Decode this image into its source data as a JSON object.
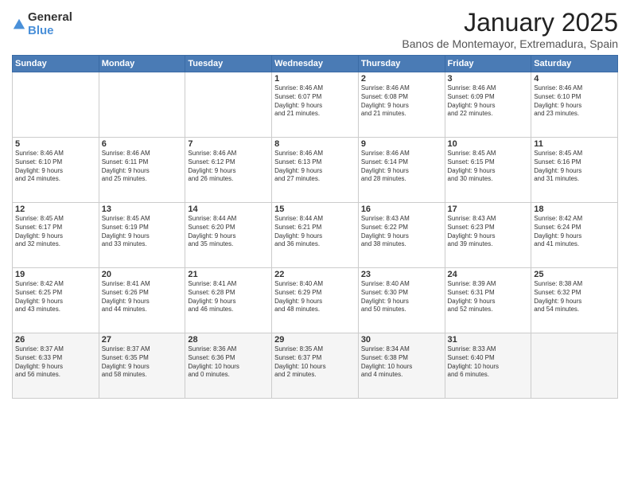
{
  "logo": {
    "general": "General",
    "blue": "Blue"
  },
  "title": "January 2025",
  "subtitle": "Banos de Montemayor, Extremadura, Spain",
  "headers": [
    "Sunday",
    "Monday",
    "Tuesday",
    "Wednesday",
    "Thursday",
    "Friday",
    "Saturday"
  ],
  "weeks": [
    [
      {
        "day": "",
        "info": ""
      },
      {
        "day": "",
        "info": ""
      },
      {
        "day": "",
        "info": ""
      },
      {
        "day": "1",
        "info": "Sunrise: 8:46 AM\nSunset: 6:07 PM\nDaylight: 9 hours\nand 21 minutes."
      },
      {
        "day": "2",
        "info": "Sunrise: 8:46 AM\nSunset: 6:08 PM\nDaylight: 9 hours\nand 21 minutes."
      },
      {
        "day": "3",
        "info": "Sunrise: 8:46 AM\nSunset: 6:09 PM\nDaylight: 9 hours\nand 22 minutes."
      },
      {
        "day": "4",
        "info": "Sunrise: 8:46 AM\nSunset: 6:10 PM\nDaylight: 9 hours\nand 23 minutes."
      }
    ],
    [
      {
        "day": "5",
        "info": "Sunrise: 8:46 AM\nSunset: 6:10 PM\nDaylight: 9 hours\nand 24 minutes."
      },
      {
        "day": "6",
        "info": "Sunrise: 8:46 AM\nSunset: 6:11 PM\nDaylight: 9 hours\nand 25 minutes."
      },
      {
        "day": "7",
        "info": "Sunrise: 8:46 AM\nSunset: 6:12 PM\nDaylight: 9 hours\nand 26 minutes."
      },
      {
        "day": "8",
        "info": "Sunrise: 8:46 AM\nSunset: 6:13 PM\nDaylight: 9 hours\nand 27 minutes."
      },
      {
        "day": "9",
        "info": "Sunrise: 8:46 AM\nSunset: 6:14 PM\nDaylight: 9 hours\nand 28 minutes."
      },
      {
        "day": "10",
        "info": "Sunrise: 8:45 AM\nSunset: 6:15 PM\nDaylight: 9 hours\nand 30 minutes."
      },
      {
        "day": "11",
        "info": "Sunrise: 8:45 AM\nSunset: 6:16 PM\nDaylight: 9 hours\nand 31 minutes."
      }
    ],
    [
      {
        "day": "12",
        "info": "Sunrise: 8:45 AM\nSunset: 6:17 PM\nDaylight: 9 hours\nand 32 minutes."
      },
      {
        "day": "13",
        "info": "Sunrise: 8:45 AM\nSunset: 6:19 PM\nDaylight: 9 hours\nand 33 minutes."
      },
      {
        "day": "14",
        "info": "Sunrise: 8:44 AM\nSunset: 6:20 PM\nDaylight: 9 hours\nand 35 minutes."
      },
      {
        "day": "15",
        "info": "Sunrise: 8:44 AM\nSunset: 6:21 PM\nDaylight: 9 hours\nand 36 minutes."
      },
      {
        "day": "16",
        "info": "Sunrise: 8:43 AM\nSunset: 6:22 PM\nDaylight: 9 hours\nand 38 minutes."
      },
      {
        "day": "17",
        "info": "Sunrise: 8:43 AM\nSunset: 6:23 PM\nDaylight: 9 hours\nand 39 minutes."
      },
      {
        "day": "18",
        "info": "Sunrise: 8:42 AM\nSunset: 6:24 PM\nDaylight: 9 hours\nand 41 minutes."
      }
    ],
    [
      {
        "day": "19",
        "info": "Sunrise: 8:42 AM\nSunset: 6:25 PM\nDaylight: 9 hours\nand 43 minutes."
      },
      {
        "day": "20",
        "info": "Sunrise: 8:41 AM\nSunset: 6:26 PM\nDaylight: 9 hours\nand 44 minutes."
      },
      {
        "day": "21",
        "info": "Sunrise: 8:41 AM\nSunset: 6:28 PM\nDaylight: 9 hours\nand 46 minutes."
      },
      {
        "day": "22",
        "info": "Sunrise: 8:40 AM\nSunset: 6:29 PM\nDaylight: 9 hours\nand 48 minutes."
      },
      {
        "day": "23",
        "info": "Sunrise: 8:40 AM\nSunset: 6:30 PM\nDaylight: 9 hours\nand 50 minutes."
      },
      {
        "day": "24",
        "info": "Sunrise: 8:39 AM\nSunset: 6:31 PM\nDaylight: 9 hours\nand 52 minutes."
      },
      {
        "day": "25",
        "info": "Sunrise: 8:38 AM\nSunset: 6:32 PM\nDaylight: 9 hours\nand 54 minutes."
      }
    ],
    [
      {
        "day": "26",
        "info": "Sunrise: 8:37 AM\nSunset: 6:33 PM\nDaylight: 9 hours\nand 56 minutes."
      },
      {
        "day": "27",
        "info": "Sunrise: 8:37 AM\nSunset: 6:35 PM\nDaylight: 9 hours\nand 58 minutes."
      },
      {
        "day": "28",
        "info": "Sunrise: 8:36 AM\nSunset: 6:36 PM\nDaylight: 10 hours\nand 0 minutes."
      },
      {
        "day": "29",
        "info": "Sunrise: 8:35 AM\nSunset: 6:37 PM\nDaylight: 10 hours\nand 2 minutes."
      },
      {
        "day": "30",
        "info": "Sunrise: 8:34 AM\nSunset: 6:38 PM\nDaylight: 10 hours\nand 4 minutes."
      },
      {
        "day": "31",
        "info": "Sunrise: 8:33 AM\nSunset: 6:40 PM\nDaylight: 10 hours\nand 6 minutes."
      },
      {
        "day": "",
        "info": ""
      }
    ]
  ]
}
